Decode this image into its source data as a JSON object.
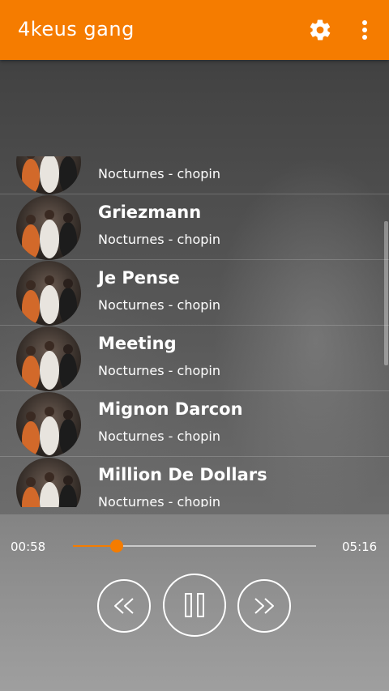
{
  "app_bar": {
    "title": "4keus gang",
    "accent_color": "#f57c00",
    "icons": [
      "gear-icon",
      "more-vertical-icon"
    ]
  },
  "tracks": [
    {
      "title": "",
      "subtitle": "Nocturnes - chopin"
    },
    {
      "title": "Griezmann",
      "subtitle": "Nocturnes - chopin"
    },
    {
      "title": "Je Pense",
      "subtitle": "Nocturnes - chopin"
    },
    {
      "title": "Meeting",
      "subtitle": "Nocturnes - chopin"
    },
    {
      "title": "Mignon Darcon",
      "subtitle": "Nocturnes - chopin"
    },
    {
      "title": "Million De Dollars",
      "subtitle": "Nocturnes - chopin"
    }
  ],
  "player": {
    "elapsed": "00:58",
    "total": "05:16",
    "progress": 0.18,
    "controls": [
      "rewind-icon",
      "pause-icon",
      "fast-forward-icon"
    ]
  }
}
